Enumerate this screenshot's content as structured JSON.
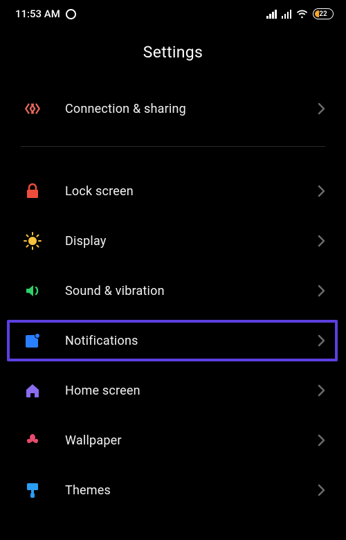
{
  "status": {
    "time": "11:53 AM",
    "battery_percent": "22"
  },
  "header": {
    "title": "Settings"
  },
  "group1": [
    {
      "id": "connection-sharing",
      "label": "Connection & sharing",
      "icon": "connection-sharing-icon",
      "color": "#ec6a5e"
    }
  ],
  "group2": [
    {
      "id": "lock-screen",
      "label": "Lock screen",
      "icon": "lock-icon",
      "color": "#ef4d3c"
    },
    {
      "id": "display",
      "label": "Display",
      "icon": "sun-icon",
      "color": "#f9c23c"
    },
    {
      "id": "sound-vibration",
      "label": "Sound & vibration",
      "icon": "speaker-icon",
      "color": "#2dcf6a"
    },
    {
      "id": "notifications",
      "label": "Notifications",
      "icon": "notifications-icon",
      "color": "#2a7fff",
      "highlighted": true
    },
    {
      "id": "home-screen",
      "label": "Home screen",
      "icon": "home-icon",
      "color": "#8a6cf0"
    },
    {
      "id": "wallpaper",
      "label": "Wallpaper",
      "icon": "flower-icon",
      "color": "#e84c6e"
    },
    {
      "id": "themes",
      "label": "Themes",
      "icon": "brush-icon",
      "color": "#2a9df4"
    }
  ]
}
